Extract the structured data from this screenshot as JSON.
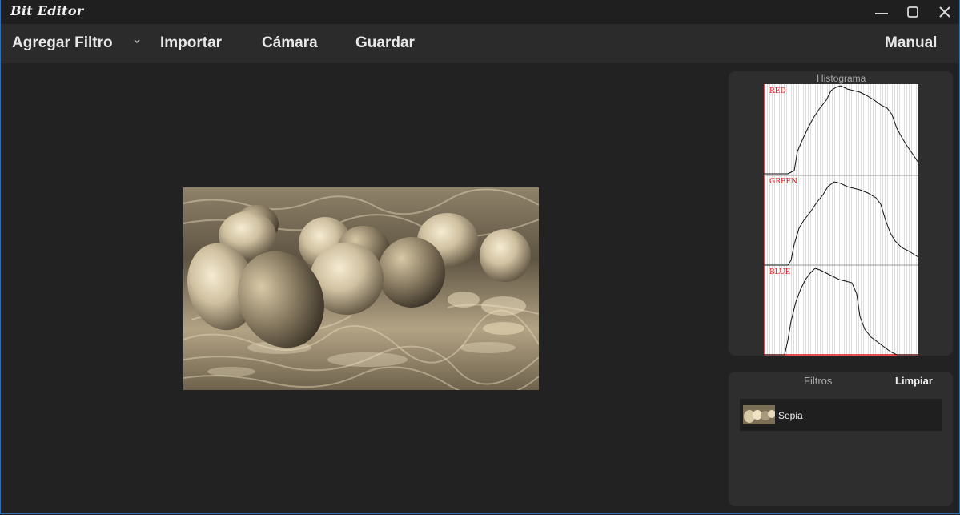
{
  "window": {
    "title": "Bit Editor",
    "controls": {
      "minimize": "—",
      "maximize": "☐",
      "close": "✕"
    }
  },
  "menu": {
    "add_filter": "Agregar Filtro",
    "import": "Importar",
    "camera": "Cámara",
    "save": "Guardar",
    "manual": "Manual"
  },
  "histogram": {
    "title": "Histograma",
    "channels": [
      {
        "label": "RED",
        "color": "#e0161a"
      },
      {
        "label": "GREEN",
        "color": "#e0161a"
      },
      {
        "label": "BLUE",
        "color": "#e0161a"
      }
    ]
  },
  "filters": {
    "title": "Filtros",
    "clear_label": "Limpiar",
    "items": [
      {
        "name": "Sepia"
      }
    ]
  },
  "colors": {
    "background": "#222222",
    "menubar": "#2b2b2b",
    "panel": "#2e2e2e",
    "sepia_light": "#e8d8b4",
    "sepia_dark": "#3a3226",
    "window_border": "#2f6fb7"
  }
}
